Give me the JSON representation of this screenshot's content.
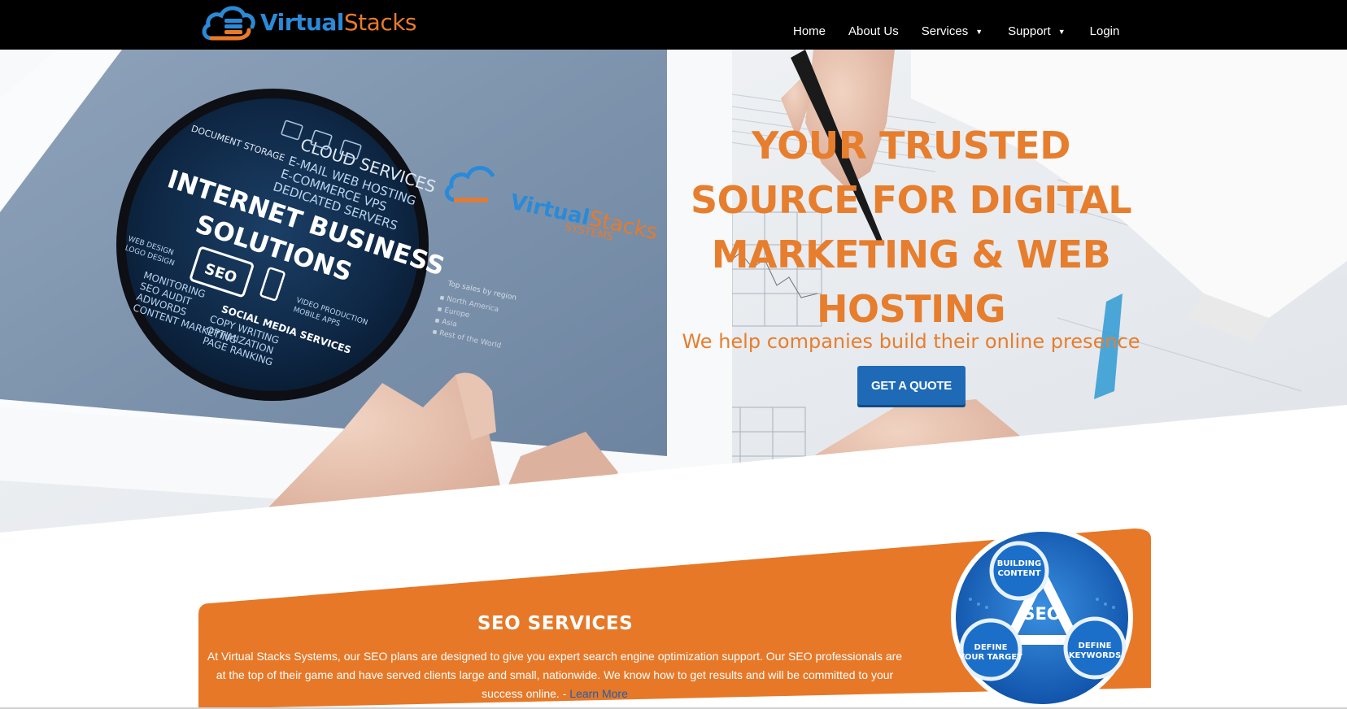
{
  "brand": {
    "name_part1": "Virtual",
    "name_part2": "Stacks",
    "blue": "#2a8ad8",
    "orange": "#e87a2a"
  },
  "nav": {
    "items": [
      {
        "label": "Home"
      },
      {
        "label": "About Us"
      },
      {
        "label": "Services",
        "has_dropdown": true
      },
      {
        "label": "Support",
        "has_dropdown": true
      },
      {
        "label": "Login"
      }
    ],
    "caret": "▼"
  },
  "hero": {
    "headline": "YOUR TRUSTED SOURCE FOR DIGITAL MARKETING & WEB HOSTING",
    "subheadline": "We help companies build their online presence",
    "cta_label": "GET A QUOTE",
    "accent_color": "#e67e2e",
    "button_color": "#1e6ab7"
  },
  "tablet_graphic": {
    "badge_lines": [
      "CLOUD SERVICES",
      "E-MAIL  WEB HOSTING",
      "E-COMMERCE  VPS",
      "DEDICATED SERVERS",
      "DOCUMENT STORAGE",
      "INTERNET BUSINESS",
      "SOLUTIONS",
      "SEO",
      "WEB DESIGN",
      "LOGO DESIGN",
      "VIDEO PRODUCTION",
      "MOBILE APPS",
      "SOCIAL MEDIA SERVICES",
      "MONITORING",
      "SEO AUDIT",
      "ADWORDS",
      "CONTENT MARKETING",
      "COPY WRITING",
      "OPTIMIZATION",
      "PAGE RANKING"
    ],
    "screen_brand": "VirtualStacks",
    "screen_brand_sub": "SYSTEMS",
    "screen_list_title": "Top sales by region",
    "screen_list": [
      "North America",
      "Europe",
      "Asia",
      "Rest of the World"
    ]
  },
  "seo": {
    "title": "SEO SERVICES",
    "body": "At Virtual Stacks Systems, our SEO plans are designed to give you expert search engine optimization support. Our SEO professionals are at the top of their game and have served clients large and small, nationwide. We know how to get results and will be committed to your success online. - ",
    "link_label": "Learn More",
    "graphic": {
      "center": "SEO",
      "top": [
        "BUILDING",
        "CONTENT"
      ],
      "left": [
        "DEFINE",
        "YOUR TARGET"
      ],
      "right": [
        "DEFINE",
        "KEYWORDS"
      ]
    },
    "banner_color": "#e87a2a"
  }
}
